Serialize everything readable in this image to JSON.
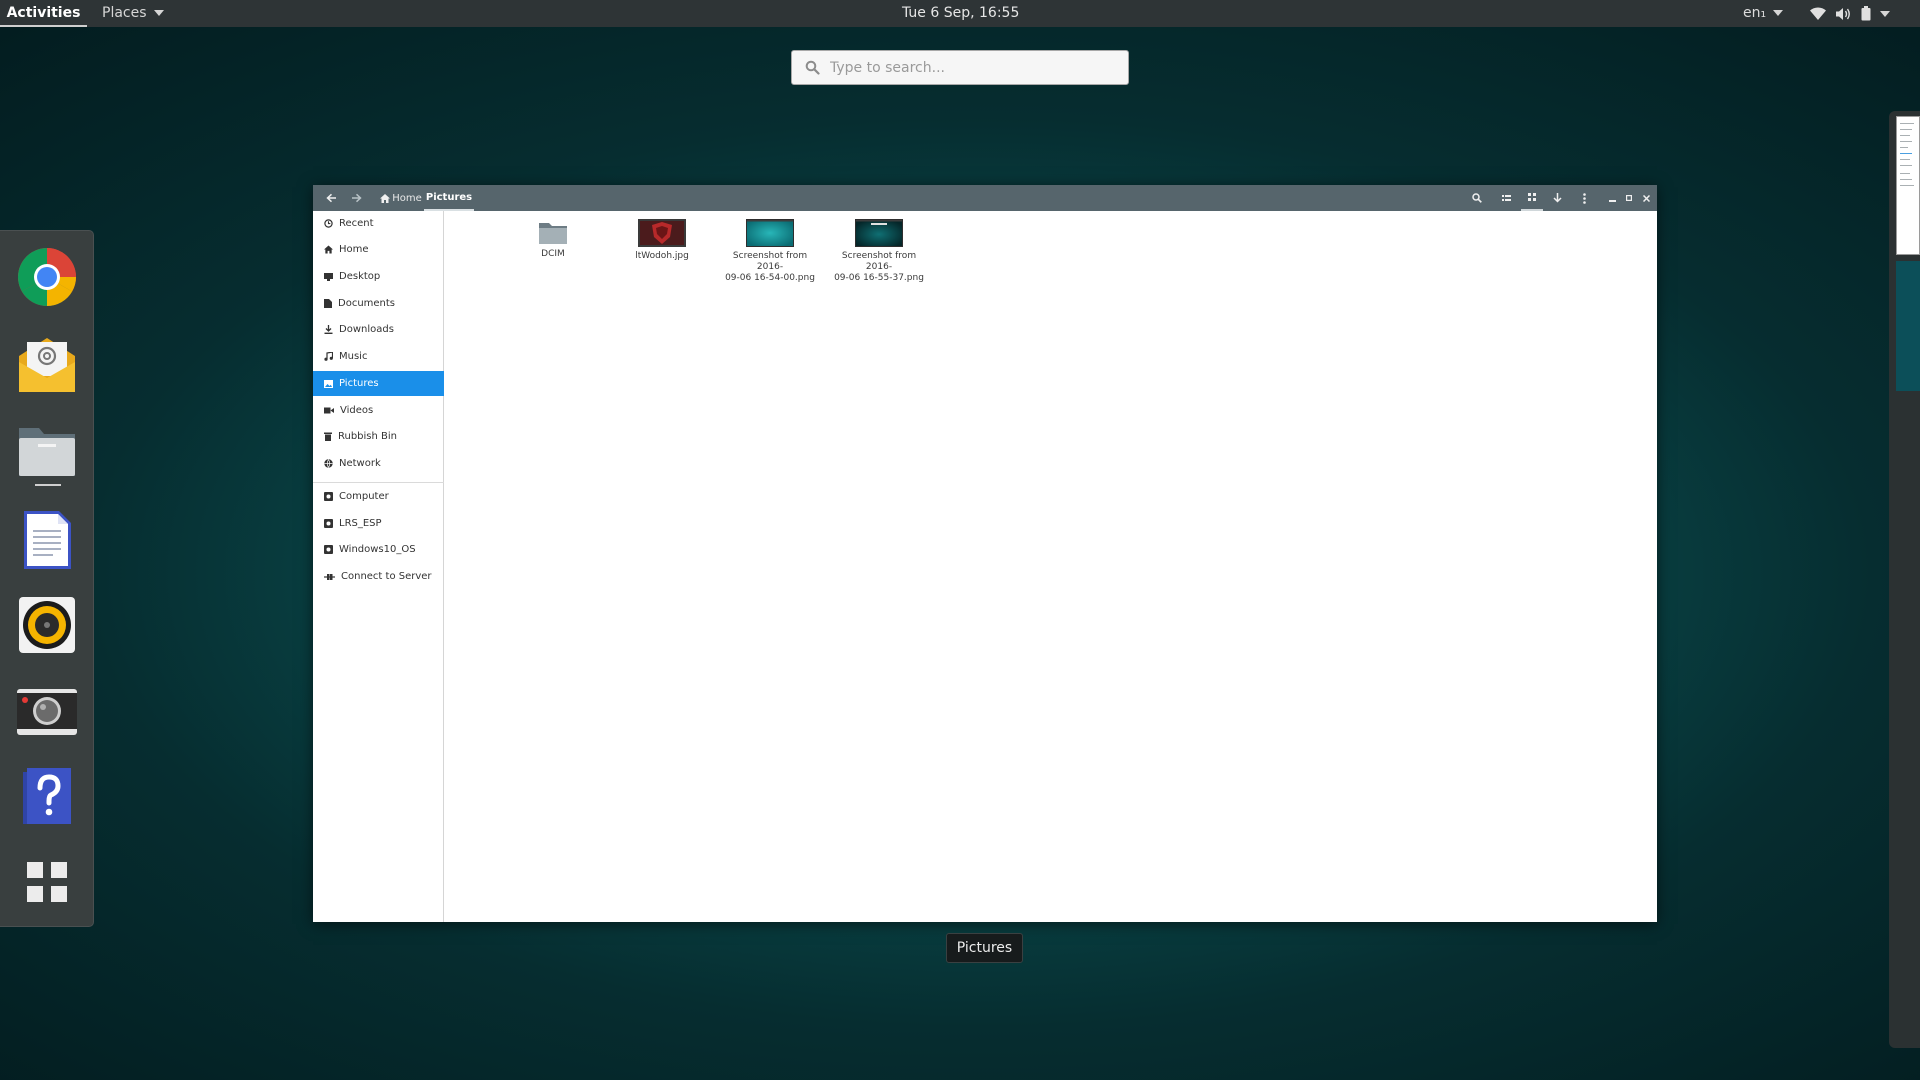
{
  "topbar": {
    "activities": "Activities",
    "places": "Places",
    "clock": "Tue  6 Sep, 16:55",
    "language": "en₁"
  },
  "search": {
    "placeholder": "Type to search..."
  },
  "dash": {
    "apps": [
      {
        "name": "Google Chrome",
        "icon": "chrome-icon"
      },
      {
        "name": "Mail",
        "icon": "mail-icon"
      },
      {
        "name": "Files",
        "icon": "files-icon",
        "running": true
      },
      {
        "name": "Writer",
        "icon": "writer-icon"
      },
      {
        "name": "Rhythmbox",
        "icon": "music-player-icon"
      },
      {
        "name": "Cheese",
        "icon": "camera-icon"
      },
      {
        "name": "Help",
        "icon": "help-icon"
      },
      {
        "name": "Show Applications",
        "icon": "app-grid-icon"
      }
    ]
  },
  "file_manager": {
    "breadcrumb": {
      "home": "Home",
      "current": "Pictures"
    },
    "sidebar": {
      "items": [
        "Recent",
        "Home",
        "Desktop",
        "Documents",
        "Downloads",
        "Music",
        "Pictures",
        "Videos",
        "Rubbish Bin",
        "Network"
      ],
      "devices": [
        "Computer",
        "LRS_ESP",
        "Windows10_OS",
        "Connect to Server"
      ],
      "active": "Pictures"
    },
    "files": [
      {
        "line1": "DCIM",
        "line2": "",
        "type": "folder"
      },
      {
        "line1": "ltWodoh.jpg",
        "line2": "",
        "type": "image"
      },
      {
        "line1": "Screenshot from 2016-",
        "line2": "09-06 16-54-00.png",
        "type": "image"
      },
      {
        "line1": "Screenshot from 2016-",
        "line2": "09-06 16-55-37.png",
        "type": "image"
      }
    ]
  },
  "window_label": "Pictures",
  "colors": {
    "sidebar_active": "#1a8fe9",
    "header_bar": "#56656c",
    "top_bar": "#2e3436"
  }
}
